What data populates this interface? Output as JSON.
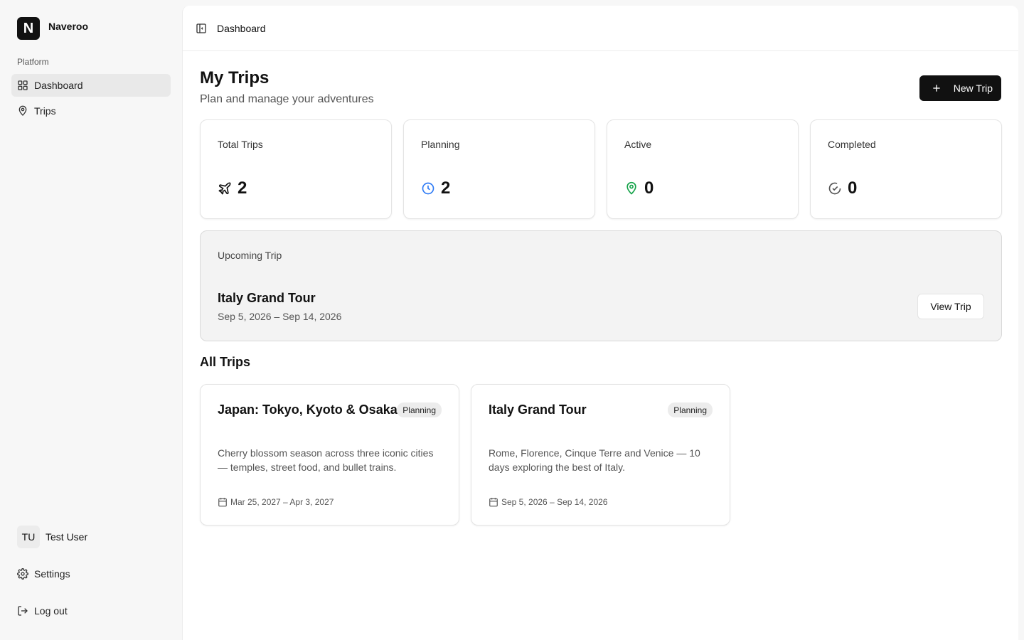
{
  "app": {
    "logo_letter": "N",
    "name": "Naveroo"
  },
  "sidebar": {
    "section_label": "Platform",
    "items": [
      {
        "label": "Dashboard",
        "icon": "grid-icon",
        "active": true
      },
      {
        "label": "Trips",
        "icon": "map-pin-icon",
        "active": false
      }
    ],
    "user": {
      "initials": "TU",
      "name": "Test User"
    },
    "settings_label": "Settings",
    "logout_label": "Log out"
  },
  "header": {
    "breadcrumb": "Dashboard"
  },
  "page": {
    "title": "My Trips",
    "subtitle": "Plan and manage your adventures",
    "new_trip_label": "New Trip"
  },
  "stats": [
    {
      "label": "Total Trips",
      "value": "2",
      "icon": "plane-icon",
      "color": "#111111"
    },
    {
      "label": "Planning",
      "value": "2",
      "icon": "clock-icon",
      "color": "#2f7bf5"
    },
    {
      "label": "Active",
      "value": "0",
      "icon": "map-pin-icon",
      "color": "#16a34a"
    },
    {
      "label": "Completed",
      "value": "0",
      "icon": "check-circle-icon",
      "color": "#555555"
    }
  ],
  "upcoming": {
    "label": "Upcoming Trip",
    "name": "Italy Grand Tour",
    "dates": "Sep 5, 2026 – Sep 14, 2026",
    "view_label": "View Trip"
  },
  "all_trips": {
    "title": "All Trips",
    "trips": [
      {
        "name": "Japan: Tokyo, Kyoto & Osaka",
        "status": "Planning",
        "description": "Cherry blossom season across three iconic cities — temples, street food, and bullet trains.",
        "dates": "Mar 25, 2027 – Apr 3, 2027"
      },
      {
        "name": "Italy Grand Tour",
        "status": "Planning",
        "description": "Rome, Florence, Cinque Terre and Venice — 10 days exploring the best of Italy.",
        "dates": "Sep 5, 2026 – Sep 14, 2026"
      }
    ]
  }
}
